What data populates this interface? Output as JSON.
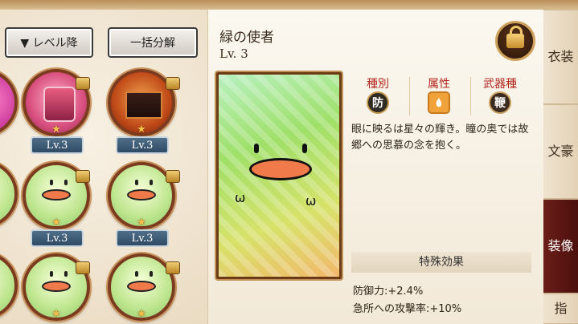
{
  "toolbar": {
    "sort_label": "▼ レベル降",
    "bulk_label": "一括分解"
  },
  "inventory": {
    "items": [
      {
        "kind": "drink",
        "level": "Lv.3"
      },
      {
        "kind": "box",
        "level": "Lv.3"
      },
      {
        "kind": "green",
        "level": "Lv.3"
      },
      {
        "kind": "green",
        "level": "Lv.3"
      },
      {
        "kind": "green",
        "level": ""
      },
      {
        "kind": "green",
        "level": ""
      }
    ]
  },
  "detail": {
    "name": "緑の使者",
    "level": "Lv. 3",
    "stats": [
      {
        "label": "種別",
        "icon_text": "防",
        "icon": "shield-type-icon"
      },
      {
        "label": "属性",
        "icon_text": "",
        "icon": "attribute-icon"
      },
      {
        "label": "武器種",
        "icon_text": "鞭",
        "icon": "whip-icon"
      }
    ],
    "description": "眼に映るは星々の輝き。瞳の奥では故郷への思慕の念を抱く。",
    "special_title": "特殊効果",
    "effects": [
      "防御力:+2.4%",
      "急所への攻撃率:+10%"
    ]
  },
  "tabs": [
    {
      "label": "衣装",
      "active": false
    },
    {
      "label": "文豪",
      "active": false
    },
    {
      "label": "装像",
      "active": true
    },
    {
      "label": "指",
      "active": false
    }
  ],
  "colors": {
    "accent_red": "#b3261e",
    "badge_blue": "#2f4a63",
    "frame_brown": "#7a3b1e",
    "active_tab": "#5a1612"
  }
}
